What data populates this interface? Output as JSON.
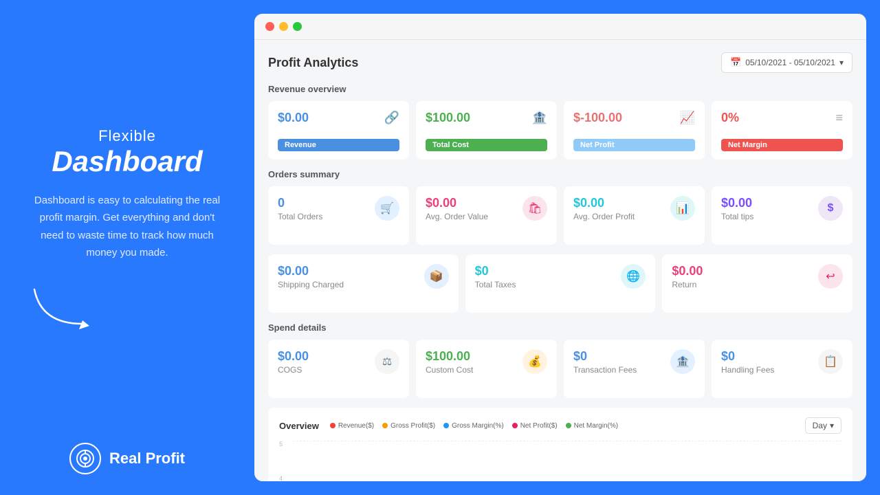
{
  "left": {
    "title_small": "Flexible",
    "title_big": "Dashboard",
    "description": "Dashboard is easy to calculating the real profit margin. Get everything and don't need to waste time to track how much money you made.",
    "brand_name": "Real Profit"
  },
  "window": {
    "dots": [
      "red",
      "yellow",
      "green"
    ]
  },
  "header": {
    "title": "Profit Analytics",
    "date_range": "05/10/2021 - 05/10/2021"
  },
  "revenue_overview": {
    "section_label": "Revenue overview",
    "cards": [
      {
        "value": "$0.00",
        "label": "Revenue",
        "color": "blue",
        "bar_color": "bar-blue",
        "icon": "🔗"
      },
      {
        "value": "$100.00",
        "label": "Total Cost",
        "color": "green",
        "bar_color": "bar-green",
        "icon": "🏦"
      },
      {
        "value": "$-100.00",
        "label": "Net Profit",
        "color": "red",
        "bar_color": "bar-red-soft",
        "icon": "📈"
      },
      {
        "value": "0%",
        "label": "Net Margin",
        "color": "coral",
        "bar_color": "bar-coral",
        "icon": "≡"
      }
    ]
  },
  "orders_summary": {
    "section_label": "Orders summary",
    "cards_row1": [
      {
        "value": "0",
        "label": "Total Orders",
        "color": "blue",
        "icon_class": "ic-blue",
        "icon": "🛒"
      },
      {
        "value": "$0.00",
        "label": "Avg. Order Value",
        "color": "pink",
        "icon_class": "ic-pink",
        "icon": "🛍"
      },
      {
        "value": "$0.00",
        "label": "Avg. Order Profit",
        "color": "teal",
        "icon_class": "ic-teal",
        "icon": "📊"
      },
      {
        "value": "$0.00",
        "label": "Total tips",
        "color": "purple",
        "icon_class": "ic-purple",
        "icon": "$"
      }
    ],
    "cards_row2": [
      {
        "value": "$0.00",
        "label": "Shipping Charged",
        "color": "blue",
        "icon_class": "ic-blue",
        "icon": "📦"
      },
      {
        "value": "$0",
        "label": "Total Taxes",
        "color": "teal",
        "icon_class": "ic-teal",
        "icon": "🌐"
      },
      {
        "value": "$0.00",
        "label": "Return",
        "color": "pink",
        "icon_class": "ic-pink",
        "icon": "↩"
      }
    ]
  },
  "spend_details": {
    "section_label": "Spend details",
    "cards": [
      {
        "value": "$0.00",
        "label": "COGS",
        "color": "blue",
        "icon_class": "ic-gray",
        "icon": "⚖"
      },
      {
        "value": "$100.00",
        "label": "Custom Cost",
        "color": "green",
        "icon_class": "ic-orange",
        "icon": "💰"
      },
      {
        "value": "$0",
        "label": "Transaction Fees",
        "color": "blue",
        "icon_class": "ic-blue",
        "icon": "🏦"
      },
      {
        "value": "$0",
        "label": "Handling Fees",
        "color": "blue",
        "icon_class": "ic-gray",
        "icon": "📋"
      }
    ]
  },
  "chart": {
    "title": "Overview",
    "day_label": "Day",
    "legend": [
      {
        "label": "Revenue($)",
        "color": "#f44336"
      },
      {
        "label": "Gross Profit($)",
        "color": "#ff9800"
      },
      {
        "label": "Gross Margin(%)",
        "color": "#2196f3"
      },
      {
        "label": "Net Profit($)",
        "color": "#e91e63"
      },
      {
        "label": "Net Margin(%)",
        "color": "#4caf50"
      }
    ],
    "y_labels": [
      "5",
      "4"
    ]
  }
}
